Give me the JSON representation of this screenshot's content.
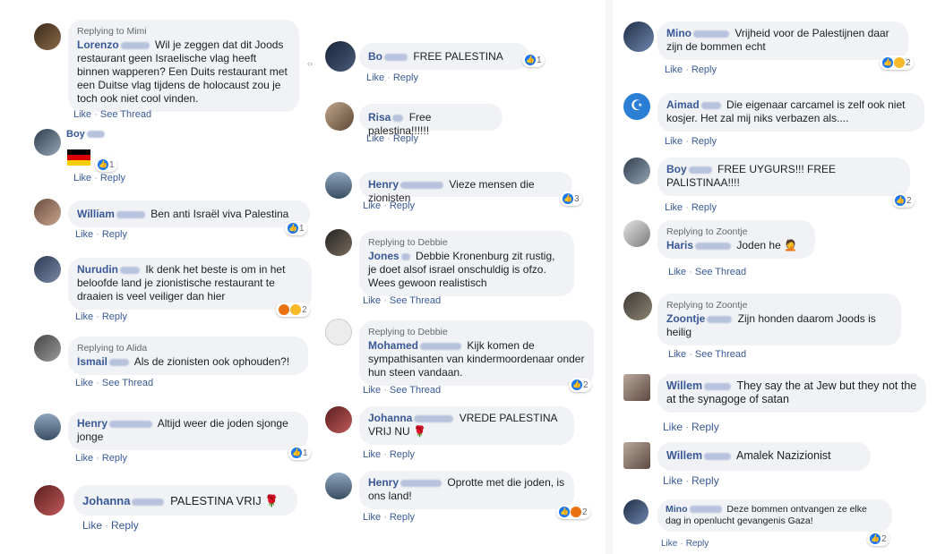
{
  "common": {
    "like": "Like",
    "reply": "Reply",
    "see_thread": "See Thread",
    "sep": "·"
  },
  "col1": [
    {
      "replying": "Replying to Mimi",
      "first": "Lorenzo",
      "text": "Wil je zeggen dat dit Joods restaurant geen Israelische vlag heeft binnen wapperen? Een Duits restaurant met een Duitse vlag tijdens de holocaust zou je toch ook niet cool vinden.",
      "actions": [
        "Like",
        "See Thread"
      ]
    },
    {
      "first": "Boy",
      "text": "",
      "flag": "germany-flag",
      "react_count": "1",
      "actions": [
        "Like",
        "Reply"
      ]
    },
    {
      "first": "William",
      "text": "Ben anti Israël viva Palestina",
      "react_count": "1",
      "actions": [
        "Like",
        "Reply"
      ]
    },
    {
      "first": "Nurudin",
      "text": "Ik denk het beste is om in het beloofde land je zionistische restaurant te draaien is veel veiliger dan hier",
      "react_count": "2",
      "actions": [
        "Like",
        "Reply"
      ]
    },
    {
      "replying": "Replying to Alida",
      "first": "Ismail",
      "text": "Als de zionisten ook ophouden?!",
      "actions": [
        "Like",
        "See Thread"
      ]
    },
    {
      "first": "Henry",
      "text": "Altijd weer die joden sjonge jonge",
      "react_count": "1",
      "actions": [
        "Like",
        "Reply"
      ]
    },
    {
      "first": "Johanna",
      "text": "PALESTINA VRIJ",
      "emoji": "🌹",
      "actions": [
        "Like",
        "Reply"
      ]
    }
  ],
  "col2": [
    {
      "first": "Bo",
      "text": "FREE PALESTINA",
      "react_count": "1",
      "actions": [
        "Like",
        "Reply"
      ]
    },
    {
      "first": "Risa",
      "text": "Free palestina!!!!!!",
      "actions": [
        "Like",
        "Reply"
      ]
    },
    {
      "first": "Henry",
      "text": "Vieze mensen die zionisten",
      "react_count": "3",
      "actions": [
        "Like",
        "Reply"
      ]
    },
    {
      "replying": "Replying to Debbie",
      "first": "Jones",
      "text": "Debbie Kronenburg zit rustig, je doet alsof israel onschuldig is ofzo. Wees gewoon realistisch",
      "actions": [
        "Like",
        "See Thread"
      ]
    },
    {
      "replying": "Replying to Debbie",
      "first": "Mohamed",
      "text": "Kijk komen de sympathisanten van kindermoordenaar onder hun steen vandaan.",
      "react_count": "2",
      "actions": [
        "Like",
        "See Thread"
      ]
    },
    {
      "first": "Johanna",
      "text": "VREDE PALESTINA VRIJ NU",
      "emoji": "🌹",
      "actions": [
        "Like",
        "Reply"
      ]
    },
    {
      "first": "Henry",
      "text": "Oprotte met die joden, is ons land!",
      "react_count": "2",
      "actions": [
        "Like",
        "Reply"
      ]
    }
  ],
  "col3": [
    {
      "first": "Mino",
      "text": "Vrijheid voor de Palestijnen daar zijn de bommen echt",
      "react_count": "2",
      "actions": [
        "Like",
        "Reply"
      ]
    },
    {
      "first": "Aimad",
      "text": "Die eigenaar carcamel is zelf ook niet kosjer. Het zal mij niks verbazen als....",
      "actions": [
        "Like",
        "Reply"
      ]
    },
    {
      "first": "Boy",
      "text": "FREE UYGURS!!! FREE PALISTINAA!!!!",
      "react_count": "2",
      "actions": [
        "Like",
        "Reply"
      ]
    },
    {
      "replying": "Replying to Zoontje",
      "first": "Haris",
      "text": "Joden he",
      "emoji": "🤦",
      "actions": [
        "Like",
        "See Thread"
      ]
    },
    {
      "replying": "Replying to Zoontje",
      "first": "Zoontje",
      "text": "Zijn honden daarom Joods is heilig",
      "actions": [
        "Like",
        "See Thread"
      ]
    },
    {
      "first": "Willem",
      "text": "They say the at Jew but they not the at the synagoge of satan",
      "actions": [
        "Like",
        "Reply"
      ]
    },
    {
      "first": "Willem",
      "text": "Amalek Nazizionist",
      "actions": [
        "Like",
        "Reply"
      ]
    },
    {
      "first": "Mino",
      "text": "Deze bommen ontvangen ze elke dag in openlucht gevangenis Gaza!",
      "react_count": "2",
      "actions": [
        "Like",
        "Reply"
      ]
    }
  ]
}
